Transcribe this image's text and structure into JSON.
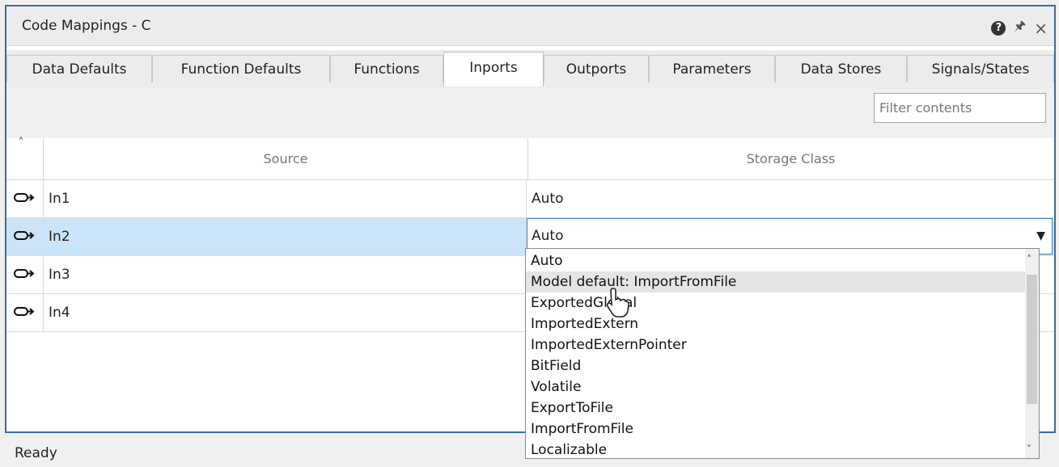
{
  "window": {
    "title": "Code Mappings - C",
    "help_icon": "help-icon",
    "pin_icon": "pin-icon",
    "close_icon": "close-icon"
  },
  "tabs": [
    {
      "label": "Data Defaults",
      "active": false
    },
    {
      "label": "Function Defaults",
      "active": false
    },
    {
      "label": "Functions",
      "active": false
    },
    {
      "label": "Inports",
      "active": true
    },
    {
      "label": "Outports",
      "active": false
    },
    {
      "label": "Parameters",
      "active": false
    },
    {
      "label": "Data Stores",
      "active": false
    },
    {
      "label": "Signals/States",
      "active": false
    }
  ],
  "toolbar": {
    "filter_placeholder": "Filter contents"
  },
  "table": {
    "columns": [
      "Source",
      "Storage Class"
    ],
    "rows": [
      {
        "source": "In1",
        "storage_class": "Auto",
        "selected": false
      },
      {
        "source": "In2",
        "storage_class": "Auto",
        "selected": true
      },
      {
        "source": "In3",
        "storage_class": "",
        "selected": false
      },
      {
        "source": "In4",
        "storage_class": "",
        "selected": false
      }
    ]
  },
  "dropdown": {
    "options": [
      "Auto",
      "Model default: ImportFromFile",
      "ExportedGlobal",
      "ImportedExtern",
      "ImportedExternPointer",
      "BitField",
      "Volatile",
      "ExportToFile",
      "ImportFromFile",
      "Localizable"
    ],
    "hovered_index": 1
  },
  "status": {
    "text": "Ready"
  },
  "colors": {
    "selection": "#cce4f7",
    "frame": "#3d6a9c"
  }
}
